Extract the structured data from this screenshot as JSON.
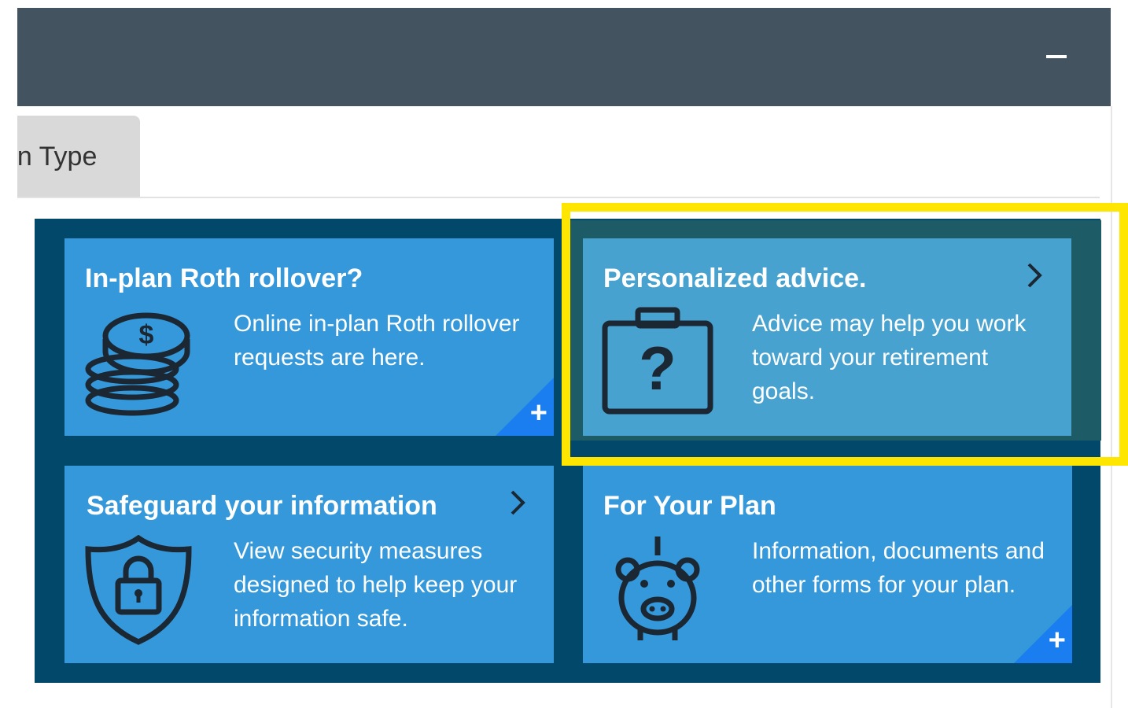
{
  "header": {
    "collapse_label": "–"
  },
  "tabs": [
    {
      "label": "on Type"
    }
  ],
  "cards": [
    {
      "title": "In-plan Roth rollover?",
      "text": "Online in-plan Roth rollover requests are here.",
      "icon": "coins-stack-icon",
      "action": "+"
    },
    {
      "title": "Personalized advice.",
      "text": "Advice may help you work toward your retirement goals.",
      "icon": "briefcase-question-icon",
      "action": "chevron-right-icon",
      "highlighted": true
    },
    {
      "title": "Safeguard your information",
      "text": "View security measures designed to help keep your information safe.",
      "icon": "shield-lock-icon",
      "action": "chevron-right-icon"
    },
    {
      "title": "For Your Plan",
      "text": "Information, documents and other forms for your plan.",
      "icon": "piggy-bank-icon",
      "action": "+"
    }
  ],
  "colors": {
    "header": "#43535f",
    "grid_bg": "#01486b",
    "card": "#3498da",
    "highlight": "#ffe600",
    "corner": "#1a7ef0"
  }
}
